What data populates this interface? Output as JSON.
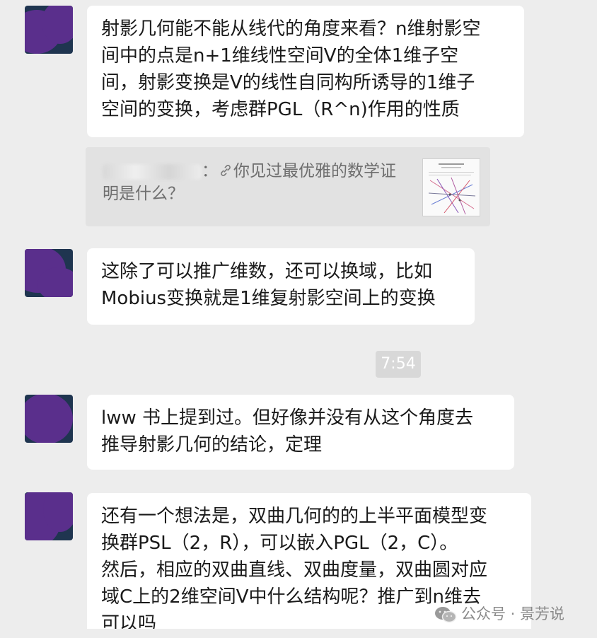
{
  "messages": [
    {
      "lines": [
        "射影几何能不能从线代的角度来看？n维射影空",
        "间中的点是n+1维线性空间V的全体1维子空",
        "间，射影变换是V的线性自同构所诱导的1维子",
        "空间的变换，考虑群PGL（R^n)作用的性质"
      ]
    },
    {
      "lines": [
        "这除了可以推广维数，还可以换域，比如",
        "Mobius变换就是1维复射影空间上的变换"
      ]
    },
    {
      "lines": [
        "lww 书上提到过。但好像并没有从这个角度去",
        "推导射影几何的结论，定理"
      ]
    },
    {
      "lines": [
        "还有一个想法是，双曲几何的的上半平面模型变",
        "换群PSL（2，R），可以嵌入PGL（2，C）。",
        "然后，相应的双曲直线、双曲度量，双曲圆对应",
        "域C上的2维空间V中什么结构呢？推广到n维去",
        "可以吗"
      ]
    }
  ],
  "quote": {
    "separator": "：",
    "link_icon": "link-icon",
    "line1": "你见过最优雅的数学证",
    "line2": "明是什么？"
  },
  "time_label": "7:54",
  "watermark": {
    "icon": "wechat-icon",
    "text": "公众号 · 景芳说"
  },
  "colors": {
    "background": "#ededed",
    "bubble": "#ffffff",
    "quote_bg": "#e2e2e2",
    "avatar_mask": "#5a2f8c"
  }
}
